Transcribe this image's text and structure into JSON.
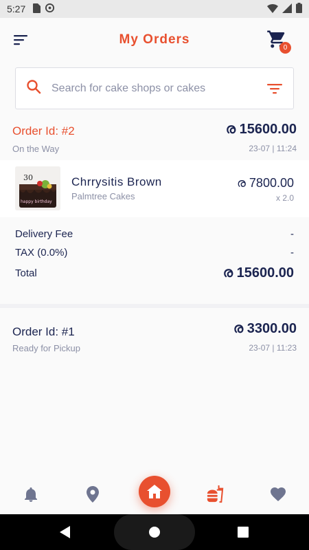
{
  "status_bar": {
    "time": "5:27"
  },
  "header": {
    "title": "My Orders",
    "cart_count": "0"
  },
  "search": {
    "placeholder": "Search for cake shops or cakes",
    "value": ""
  },
  "orders": [
    {
      "id": "Order Id: #2",
      "status": "On the Way",
      "total": "ര 15600.00",
      "date": "23-07 | 11:24",
      "items": [
        {
          "name": "Chrrysitis  Brown",
          "shop": "Palmtree Cakes",
          "price": "ര 7800.00",
          "qty": "x 2.0"
        }
      ],
      "summary": {
        "delivery_label": "Delivery Fee",
        "delivery_value": "-",
        "tax_label": "TAX (0.0%)",
        "tax_value": "-",
        "total_label": "Total",
        "total_value": "ര 15600.00"
      }
    },
    {
      "id": "Order Id: #1",
      "status": "Ready for Pickup",
      "total": "ര 3300.00",
      "date": "23-07 | 11:23"
    }
  ],
  "colors": {
    "accent": "#e8502f",
    "text_dark": "#1b2450",
    "text_muted": "#8c90a6",
    "icon_muted": "#6f7590"
  },
  "bottom_nav": [
    "bell-icon",
    "location-pin-icon",
    "home-icon",
    "food-icon",
    "heart-icon"
  ]
}
